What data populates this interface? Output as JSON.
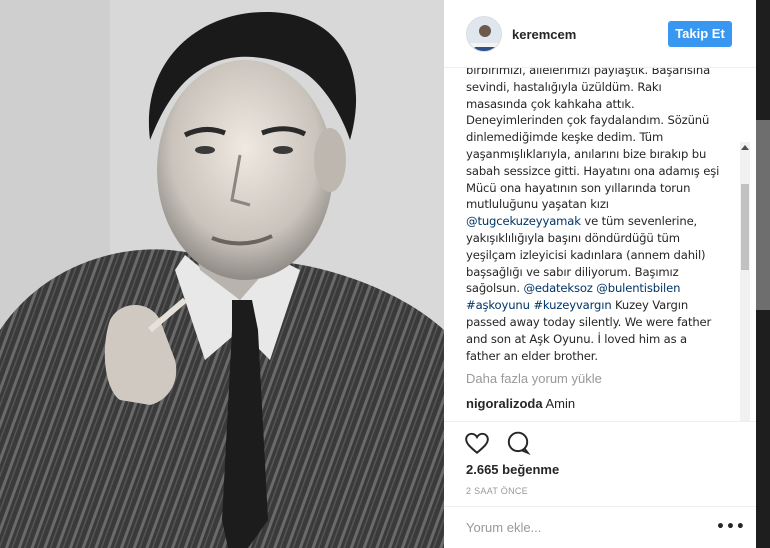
{
  "post": {
    "username": "keremcem",
    "follow_label": "Takip Et",
    "caption_lines": [
      [
        {
          "t": "birbirimizi, ailelerimizi paylaştık. Başarısına"
        }
      ],
      [
        {
          "t": "sevindi, hastalığıyla üzüldüm. Rakı"
        }
      ],
      [
        {
          "t": "masasında çok kahkaha attık."
        }
      ],
      [
        {
          "t": "Deneyimlerinden çok faydalandım. Sözünü"
        }
      ],
      [
        {
          "t": "dinlemediğimde keşke dedim. Tüm"
        }
      ],
      [
        {
          "t": "yaşanmışlıklarıyla, anılarını bize bırakıp bu"
        }
      ],
      [
        {
          "t": "sabah sessizce gitti. Hayatını ona adamış eşi"
        }
      ],
      [
        {
          "t": "Mücü ona hayatının son yıllarında torun"
        }
      ],
      [
        {
          "t": "mutluluğunu yaşatan kızı"
        }
      ],
      [
        {
          "t": "@tugcekuzeyyamak",
          "m": true
        },
        {
          "t": " ve tüm sevenlerine,"
        }
      ],
      [
        {
          "t": "yakışıklılığıyla başını döndürdüğü tüm"
        }
      ],
      [
        {
          "t": "yeşilçam izleyicisi kadınlara (annem dahil)"
        }
      ],
      [
        {
          "t": "başsağlığı ve sabır diliyorum. Başımız"
        }
      ],
      [
        {
          "t": "sağolsun. "
        },
        {
          "t": "@edateksoz",
          "m": true
        },
        {
          "t": " "
        },
        {
          "t": "@bulentisbilen",
          "m": true
        }
      ],
      [
        {
          "t": "#aşkoyunu",
          "m": true
        },
        {
          "t": " "
        },
        {
          "t": "#kuzeyvargın",
          "m": true
        },
        {
          "t": " Kuzey Vargın"
        }
      ],
      [
        {
          "t": "passed away today silently. We were father"
        }
      ],
      [
        {
          "t": "and son at Aşk Oyunu. İ loved him as a"
        }
      ],
      [
        {
          "t": "father an elder brother."
        }
      ]
    ],
    "load_more_label": "Daha fazla yorum yükle",
    "comments": [
      {
        "user": "nigoralizoda",
        "text": "Amin"
      },
      {
        "user": "",
        "text": ""
      }
    ],
    "likes": "2.665 beğenme",
    "time": "2 SAAT ÖNCE",
    "comment_placeholder": "Yorum ekle...",
    "more_label": "•••"
  },
  "icons": {
    "like": "heart-icon",
    "comment": "speech-bubble-icon",
    "scroll_up": "arrow-up-icon",
    "scroll_down": "arrow-down-icon"
  },
  "colors": {
    "follow_button": "#3897f0",
    "mention": "#003569",
    "muted_text": "#999999"
  }
}
